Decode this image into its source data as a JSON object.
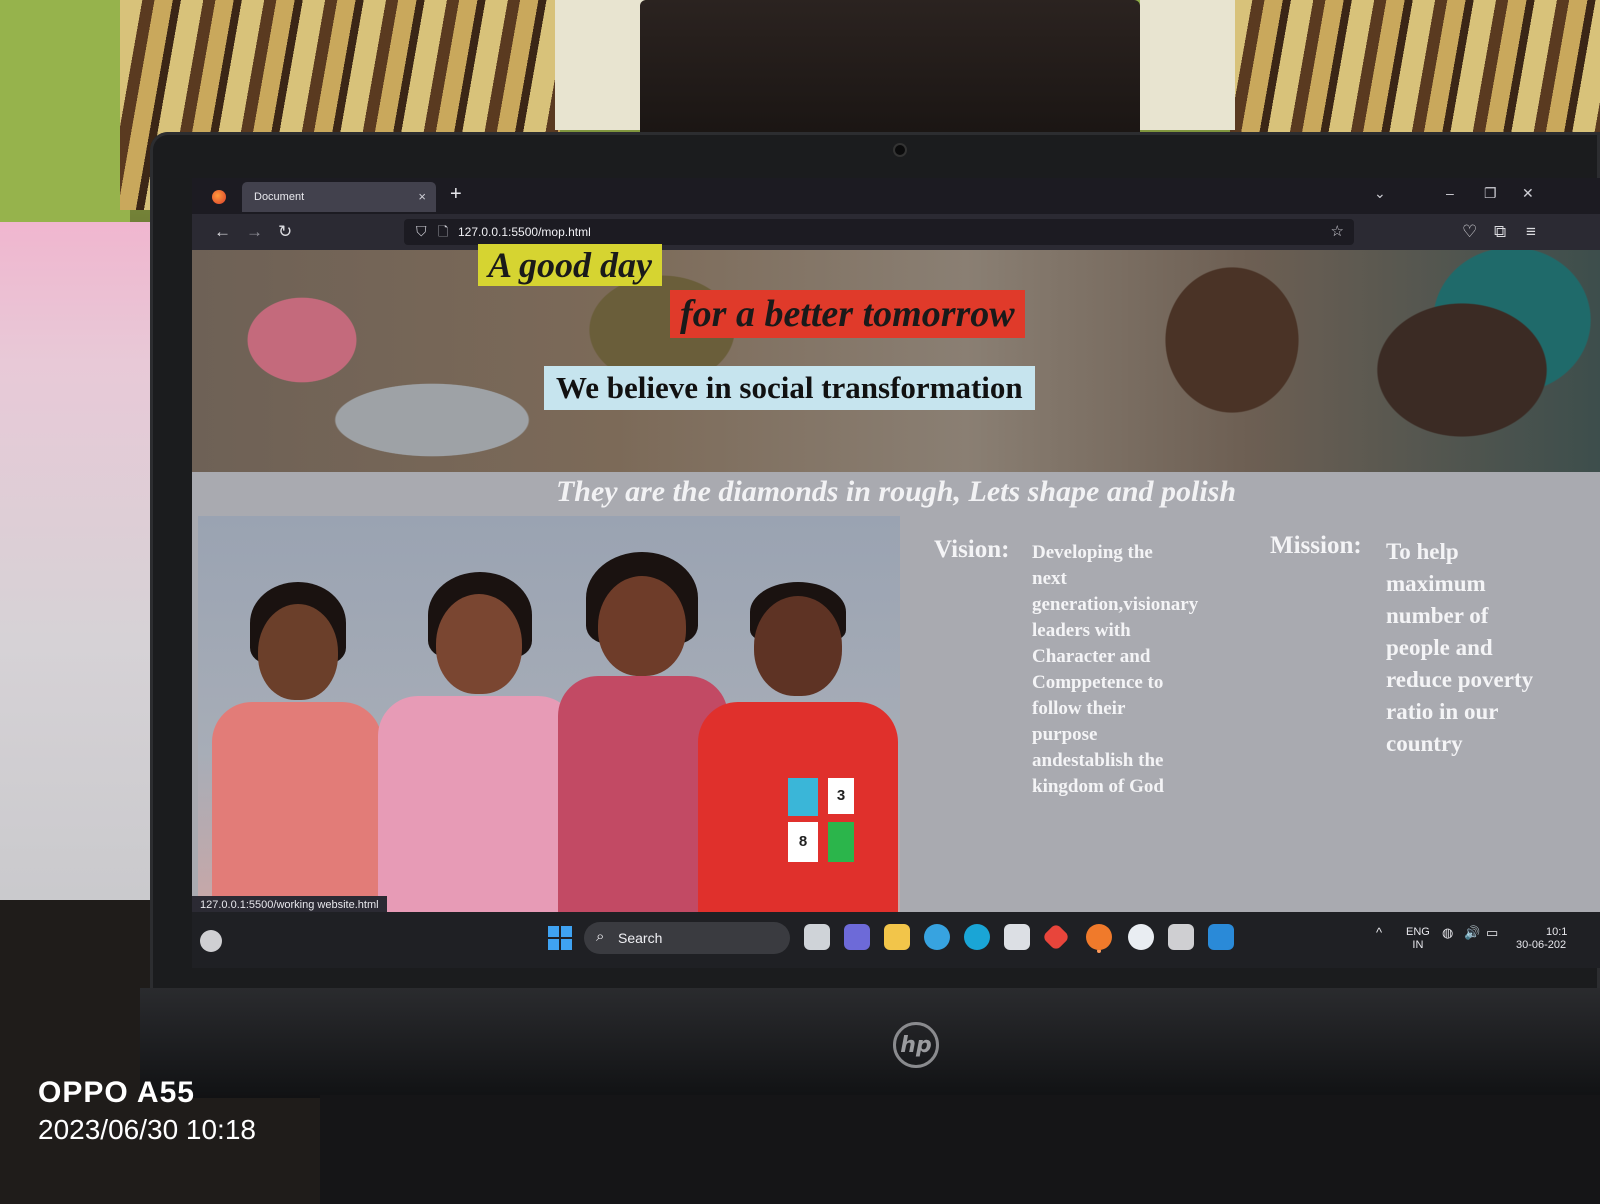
{
  "browser": {
    "tab_title": "Document",
    "tab_close": "×",
    "new_tab": "+",
    "url": "127.0.0.1:5500/mop.html",
    "status_link": "127.0.0.1:5500/working website.html"
  },
  "page": {
    "hero_line1": "A good day",
    "hero_line2": "for a better tomorrow",
    "hero_line3": "We believe in social transformation",
    "tagline": "They are the diamonds in rough, Lets shape and polish",
    "vision_label": "Vision:",
    "vision_text": "Developing the\nnext\ngeneration,visionary\nleaders with\nCharacter and\nComppetence to\nfollow their\npurpose\nandestablish the\nkingdom of God",
    "mission_label": "Mission:",
    "mission_text": "To help\nmaximum\nnumber of\npeople and\nreduce poverty\nratio in our\ncountry",
    "kid_badge_numbers": [
      "3",
      "8"
    ]
  },
  "taskbar": {
    "search_label": "Search",
    "lang_top": "ENG",
    "lang_bottom": "IN",
    "time": "10:1",
    "date": "30-06-202"
  },
  "watermark": {
    "model": "OPPO A55",
    "datetime": "2023/06/30 10:18"
  },
  "colors": {
    "hero_line1_bg": "#d6d431",
    "hero_line2_bg": "#e03a2a",
    "hero_line3_bg": "#c6e4ee",
    "page_bg": "#a9aab0",
    "browser_chrome": "#2b2a33"
  }
}
